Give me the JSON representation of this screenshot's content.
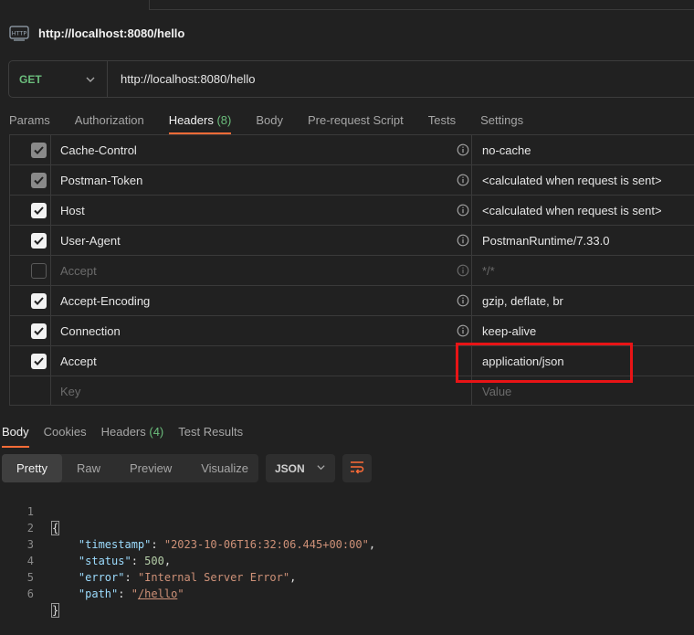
{
  "request": {
    "title": "http://localhost:8080/hello",
    "method": "GET",
    "url": "http://localhost:8080/hello"
  },
  "tabs": [
    {
      "label": "Params"
    },
    {
      "label": "Authorization"
    },
    {
      "label": "Headers",
      "count": "(8)"
    },
    {
      "label": "Body"
    },
    {
      "label": "Pre-request Script"
    },
    {
      "label": "Tests"
    },
    {
      "label": "Settings"
    }
  ],
  "headers": [
    {
      "key": "Cache-Control",
      "value": "no-cache",
      "state": "dim"
    },
    {
      "key": "Postman-Token",
      "value": "<calculated when request is sent>",
      "state": "dim"
    },
    {
      "key": "Host",
      "value": "<calculated when request is sent>",
      "state": "on"
    },
    {
      "key": "User-Agent",
      "value": "PostmanRuntime/7.33.0",
      "state": "on"
    },
    {
      "key": "Accept",
      "value": "*/*",
      "state": "off"
    },
    {
      "key": "Accept-Encoding",
      "value": "gzip, deflate, br",
      "state": "on"
    },
    {
      "key": "Connection",
      "value": "keep-alive",
      "state": "on"
    },
    {
      "key": "Accept",
      "value": "application/json",
      "state": "on"
    }
  ],
  "new_row": {
    "key_placeholder": "Key",
    "value_placeholder": "Value"
  },
  "response_tabs": [
    {
      "label": "Body"
    },
    {
      "label": "Cookies"
    },
    {
      "label": "Headers",
      "count": "(4)"
    },
    {
      "label": "Test Results"
    }
  ],
  "view_modes": [
    "Pretty",
    "Raw",
    "Preview",
    "Visualize"
  ],
  "format": "JSON",
  "response_body": {
    "line_numbers": [
      "1",
      "2",
      "3",
      "4",
      "5",
      "6"
    ],
    "open_brace": "{",
    "close_brace": "}",
    "timestamp_key": "\"timestamp\"",
    "timestamp_value": "\"2023-10-06T16:32:06.445+00:00\"",
    "status_key": "\"status\"",
    "status_value": "500",
    "error_key": "\"error\"",
    "error_value": "\"Internal Server Error\"",
    "path_key": "\"path\"",
    "path_value": "/hello"
  },
  "colors": {
    "accent": "#ff6c37",
    "method_green": "#6bbd7c",
    "highlight_red": "#e81416"
  }
}
